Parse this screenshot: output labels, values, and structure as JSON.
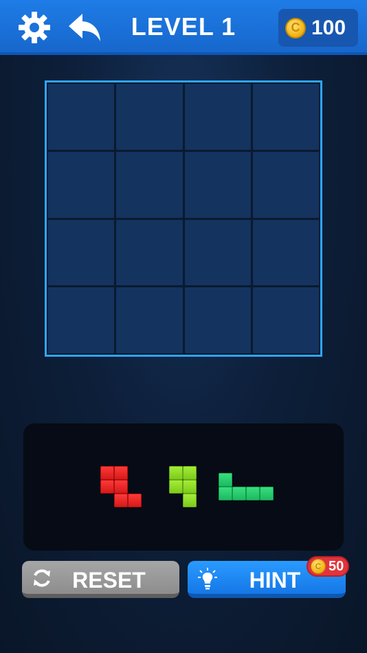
{
  "header": {
    "settings_icon": "gear-icon",
    "undo_icon": "undo-arrow-icon",
    "title": "LEVEL 1",
    "coin_symbol": "C",
    "coins": "100"
  },
  "board": {
    "rows": 4,
    "cols": 4,
    "filled_cells": 0
  },
  "tray": {
    "pieces": [
      {
        "name": "red-z-piece",
        "color": "#e32424",
        "cells": [
          [
            0,
            0
          ],
          [
            1,
            0
          ],
          [
            0,
            1
          ],
          [
            1,
            1
          ],
          [
            1,
            2
          ],
          [
            2,
            2
          ]
        ]
      },
      {
        "name": "lime-piece",
        "color": "#8fdc26",
        "cells": [
          [
            0,
            0
          ],
          [
            1,
            0
          ],
          [
            0,
            1
          ],
          [
            1,
            1
          ],
          [
            1,
            2
          ]
        ]
      },
      {
        "name": "green-l-piece",
        "color": "#27cc6c",
        "cells": [
          [
            0,
            0
          ],
          [
            0,
            1
          ],
          [
            1,
            1
          ],
          [
            2,
            1
          ],
          [
            3,
            1
          ]
        ]
      }
    ]
  },
  "buttons": {
    "reset_label": "RESET",
    "reset_icon": "refresh-icon",
    "hint_label": "HINT",
    "hint_icon": "lightbulb-icon",
    "hint_cost": "50",
    "hint_cost_symbol": "C"
  },
  "colors": {
    "accent": "#1e7ce6",
    "board_border": "#2ea6ff",
    "cell": "#14335f"
  }
}
